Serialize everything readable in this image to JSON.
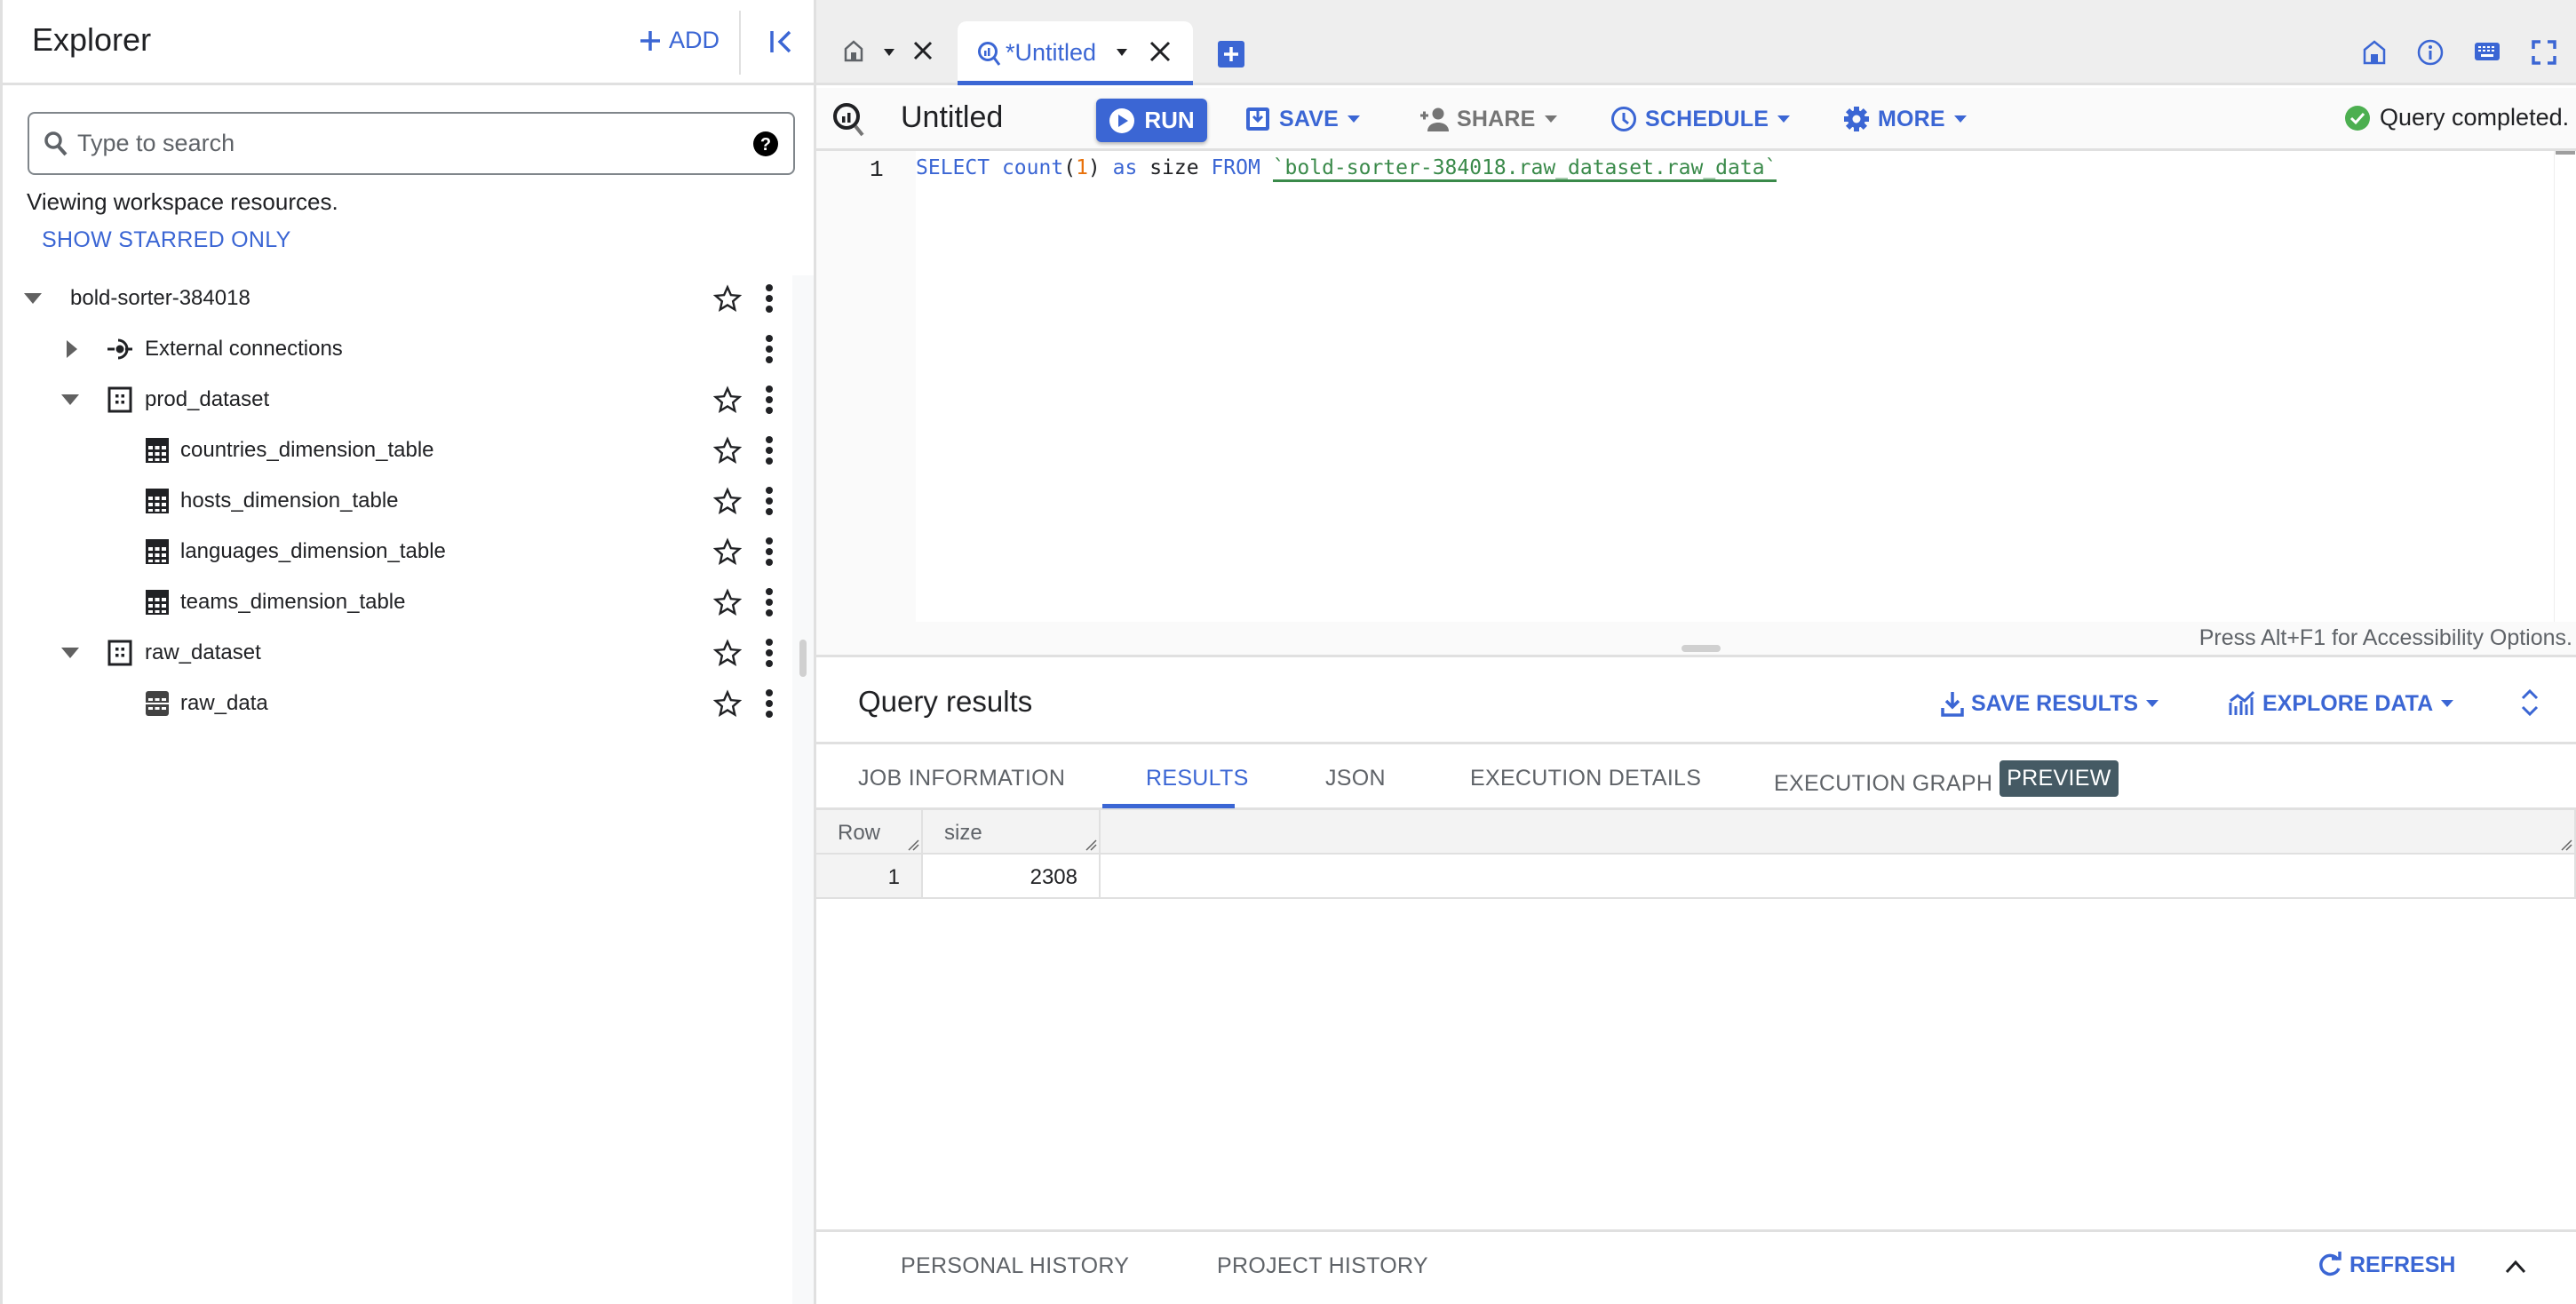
{
  "explorer": {
    "title": "Explorer",
    "add_label": "ADD",
    "search_placeholder": "Type to search",
    "search_value": "",
    "viewing_text": "Viewing workspace resources.",
    "show_starred_label": "SHOW STARRED ONLY",
    "tree": [
      {
        "label": "bold-sorter-384018",
        "type": "project",
        "expanded": true,
        "starrable": true,
        "icon": "none"
      },
      {
        "label": "External connections",
        "type": "connections",
        "expanded": false,
        "starrable": false,
        "icon": "external-connection-icon"
      },
      {
        "label": "prod_dataset",
        "type": "dataset",
        "expanded": true,
        "starrable": true,
        "icon": "dataset-icon"
      },
      {
        "label": "countries_dimension_table",
        "type": "table",
        "starrable": true,
        "icon": "table-icon"
      },
      {
        "label": "hosts_dimension_table",
        "type": "table",
        "starrable": true,
        "icon": "table-icon"
      },
      {
        "label": "languages_dimension_table",
        "type": "table",
        "starrable": true,
        "icon": "table-icon"
      },
      {
        "label": "teams_dimension_table",
        "type": "table",
        "starrable": true,
        "icon": "table-icon"
      },
      {
        "label": "raw_dataset",
        "type": "dataset",
        "expanded": true,
        "starrable": true,
        "icon": "dataset-icon"
      },
      {
        "label": "raw_data",
        "type": "table",
        "starrable": true,
        "icon": "external-table-icon"
      }
    ]
  },
  "tabs": {
    "home_icon": "home-icon",
    "active_tab_label": "*Untitled",
    "active_tab_icon": "query-icon"
  },
  "toolbar": {
    "title": "Untitled",
    "run_label": "RUN",
    "save_label": "SAVE",
    "share_label": "SHARE",
    "schedule_label": "SCHEDULE",
    "more_label": "MORE",
    "status": "Query completed."
  },
  "editor": {
    "line_number": "1",
    "tokens": [
      {
        "text": "SELECT",
        "kind": "kw"
      },
      {
        "text": " ",
        "kind": "id"
      },
      {
        "text": "count",
        "kind": "kw"
      },
      {
        "text": "(",
        "kind": "id"
      },
      {
        "text": "1",
        "kind": "num"
      },
      {
        "text": ")",
        "kind": "id"
      },
      {
        "text": " ",
        "kind": "id"
      },
      {
        "text": "as",
        "kind": "kw"
      },
      {
        "text": " size ",
        "kind": "id"
      },
      {
        "text": "FROM",
        "kind": "kw"
      },
      {
        "text": " ",
        "kind": "id"
      },
      {
        "text": "`bold-sorter-384018.raw_dataset.raw_data`",
        "kind": "str"
      }
    ],
    "accessibility_hint": "Press Alt+F1 for Accessibility Options."
  },
  "results": {
    "title": "Query results",
    "save_results_label": "SAVE RESULTS",
    "explore_data_label": "EXPLORE DATA",
    "tabs": [
      {
        "label": "JOB INFORMATION",
        "active": false
      },
      {
        "label": "RESULTS",
        "active": true
      },
      {
        "label": "JSON",
        "active": false
      },
      {
        "label": "EXECUTION DETAILS",
        "active": false
      },
      {
        "label": "EXECUTION GRAPH",
        "active": false,
        "badge": "PREVIEW"
      }
    ],
    "table": {
      "columns": [
        "Row",
        "size"
      ],
      "rows": [
        [
          "1",
          "2308"
        ]
      ]
    }
  },
  "history": {
    "personal_label": "PERSONAL HISTORY",
    "project_label": "PROJECT HISTORY",
    "refresh_label": "REFRESH"
  },
  "colors": {
    "accent": "#3b66d4",
    "success": "#4caf50",
    "badge": "#455a64"
  }
}
